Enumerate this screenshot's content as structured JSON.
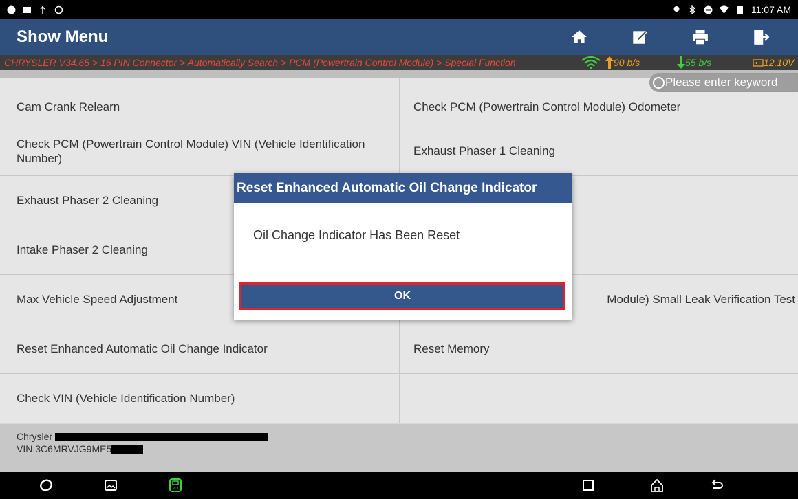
{
  "status_bar": {
    "time": "11:07 AM"
  },
  "header": {
    "title": "Show Menu",
    "buttons": [
      {
        "name": "home-button",
        "icon": "home-icon"
      },
      {
        "name": "edit-button",
        "icon": "edit-icon"
      },
      {
        "name": "print-button",
        "icon": "print-icon"
      },
      {
        "name": "exit-button",
        "icon": "exit-icon"
      }
    ]
  },
  "breadcrumb": {
    "path": "CHRYSLER V34.65 > 16 PIN Connector > Automatically Search > PCM (Powertrain Control Module) > Special Function",
    "upload": "90 b/s",
    "download": "55 b/s",
    "voltage": "12.10V"
  },
  "search": {
    "placeholder": "Please enter keyword"
  },
  "menu": {
    "rows": [
      [
        "Cam Crank Relearn",
        "Check PCM (Powertrain Control Module) Odometer"
      ],
      [
        "Check PCM (Powertrain Control Module) VIN (Vehicle Identification Number)",
        "Exhaust Phaser 1 Cleaning"
      ],
      [
        "Exhaust Phaser 2 Cleaning",
        ""
      ],
      [
        "Intake Phaser 2 Cleaning",
        ""
      ],
      [
        "Max Vehicle Speed Adjustment",
        "Module) Small Leak Verification Test"
      ],
      [
        "Reset Enhanced Automatic Oil Change Indicator",
        "Reset Memory"
      ],
      [
        "Check VIN (Vehicle Identification Number)",
        ""
      ]
    ]
  },
  "vehicle": {
    "make": "Chrysler",
    "vin": "VIN 3C6MRVJG9ME5"
  },
  "dialog": {
    "title": "Reset Enhanced Automatic Oil Change Indicator",
    "message": "Oil Change Indicator Has Been Reset",
    "ok_label": "OK"
  },
  "colors": {
    "header": "#2f4f7d",
    "breadcrumb_text": "#e8493c",
    "dialog_title": "#34588f",
    "highlight": "#e0232b",
    "wifi": "#3fcf3f",
    "upload": "#f0a020",
    "download": "#3fcf3f"
  }
}
